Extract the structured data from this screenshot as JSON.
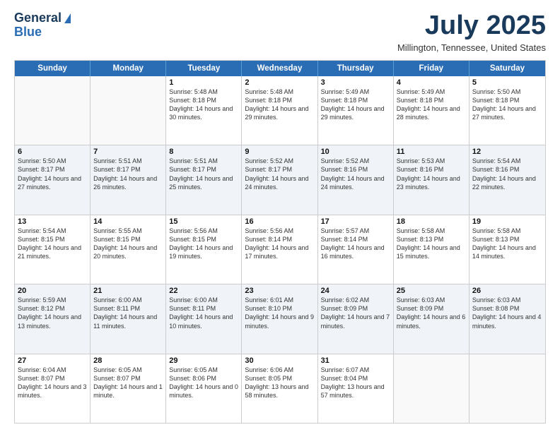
{
  "logo": {
    "line1": "General",
    "line2": "Blue"
  },
  "title": {
    "month_year": "July 2025",
    "location": "Millington, Tennessee, United States"
  },
  "weekdays": [
    "Sunday",
    "Monday",
    "Tuesday",
    "Wednesday",
    "Thursday",
    "Friday",
    "Saturday"
  ],
  "weeks": [
    [
      {
        "day": "",
        "sunrise": "",
        "sunset": "",
        "daylight": "",
        "empty": true
      },
      {
        "day": "",
        "sunrise": "",
        "sunset": "",
        "daylight": "",
        "empty": true
      },
      {
        "day": "1",
        "sunrise": "Sunrise: 5:48 AM",
        "sunset": "Sunset: 8:18 PM",
        "daylight": "Daylight: 14 hours and 30 minutes."
      },
      {
        "day": "2",
        "sunrise": "Sunrise: 5:48 AM",
        "sunset": "Sunset: 8:18 PM",
        "daylight": "Daylight: 14 hours and 29 minutes."
      },
      {
        "day": "3",
        "sunrise": "Sunrise: 5:49 AM",
        "sunset": "Sunset: 8:18 PM",
        "daylight": "Daylight: 14 hours and 29 minutes."
      },
      {
        "day": "4",
        "sunrise": "Sunrise: 5:49 AM",
        "sunset": "Sunset: 8:18 PM",
        "daylight": "Daylight: 14 hours and 28 minutes."
      },
      {
        "day": "5",
        "sunrise": "Sunrise: 5:50 AM",
        "sunset": "Sunset: 8:18 PM",
        "daylight": "Daylight: 14 hours and 27 minutes."
      }
    ],
    [
      {
        "day": "6",
        "sunrise": "Sunrise: 5:50 AM",
        "sunset": "Sunset: 8:17 PM",
        "daylight": "Daylight: 14 hours and 27 minutes."
      },
      {
        "day": "7",
        "sunrise": "Sunrise: 5:51 AM",
        "sunset": "Sunset: 8:17 PM",
        "daylight": "Daylight: 14 hours and 26 minutes."
      },
      {
        "day": "8",
        "sunrise": "Sunrise: 5:51 AM",
        "sunset": "Sunset: 8:17 PM",
        "daylight": "Daylight: 14 hours and 25 minutes."
      },
      {
        "day": "9",
        "sunrise": "Sunrise: 5:52 AM",
        "sunset": "Sunset: 8:17 PM",
        "daylight": "Daylight: 14 hours and 24 minutes."
      },
      {
        "day": "10",
        "sunrise": "Sunrise: 5:52 AM",
        "sunset": "Sunset: 8:16 PM",
        "daylight": "Daylight: 14 hours and 24 minutes."
      },
      {
        "day": "11",
        "sunrise": "Sunrise: 5:53 AM",
        "sunset": "Sunset: 8:16 PM",
        "daylight": "Daylight: 14 hours and 23 minutes."
      },
      {
        "day": "12",
        "sunrise": "Sunrise: 5:54 AM",
        "sunset": "Sunset: 8:16 PM",
        "daylight": "Daylight: 14 hours and 22 minutes."
      }
    ],
    [
      {
        "day": "13",
        "sunrise": "Sunrise: 5:54 AM",
        "sunset": "Sunset: 8:15 PM",
        "daylight": "Daylight: 14 hours and 21 minutes."
      },
      {
        "day": "14",
        "sunrise": "Sunrise: 5:55 AM",
        "sunset": "Sunset: 8:15 PM",
        "daylight": "Daylight: 14 hours and 20 minutes."
      },
      {
        "day": "15",
        "sunrise": "Sunrise: 5:56 AM",
        "sunset": "Sunset: 8:15 PM",
        "daylight": "Daylight: 14 hours and 19 minutes."
      },
      {
        "day": "16",
        "sunrise": "Sunrise: 5:56 AM",
        "sunset": "Sunset: 8:14 PM",
        "daylight": "Daylight: 14 hours and 17 minutes."
      },
      {
        "day": "17",
        "sunrise": "Sunrise: 5:57 AM",
        "sunset": "Sunset: 8:14 PM",
        "daylight": "Daylight: 14 hours and 16 minutes."
      },
      {
        "day": "18",
        "sunrise": "Sunrise: 5:58 AM",
        "sunset": "Sunset: 8:13 PM",
        "daylight": "Daylight: 14 hours and 15 minutes."
      },
      {
        "day": "19",
        "sunrise": "Sunrise: 5:58 AM",
        "sunset": "Sunset: 8:13 PM",
        "daylight": "Daylight: 14 hours and 14 minutes."
      }
    ],
    [
      {
        "day": "20",
        "sunrise": "Sunrise: 5:59 AM",
        "sunset": "Sunset: 8:12 PM",
        "daylight": "Daylight: 14 hours and 13 minutes."
      },
      {
        "day": "21",
        "sunrise": "Sunrise: 6:00 AM",
        "sunset": "Sunset: 8:11 PM",
        "daylight": "Daylight: 14 hours and 11 minutes."
      },
      {
        "day": "22",
        "sunrise": "Sunrise: 6:00 AM",
        "sunset": "Sunset: 8:11 PM",
        "daylight": "Daylight: 14 hours and 10 minutes."
      },
      {
        "day": "23",
        "sunrise": "Sunrise: 6:01 AM",
        "sunset": "Sunset: 8:10 PM",
        "daylight": "Daylight: 14 hours and 9 minutes."
      },
      {
        "day": "24",
        "sunrise": "Sunrise: 6:02 AM",
        "sunset": "Sunset: 8:09 PM",
        "daylight": "Daylight: 14 hours and 7 minutes."
      },
      {
        "day": "25",
        "sunrise": "Sunrise: 6:03 AM",
        "sunset": "Sunset: 8:09 PM",
        "daylight": "Daylight: 14 hours and 6 minutes."
      },
      {
        "day": "26",
        "sunrise": "Sunrise: 6:03 AM",
        "sunset": "Sunset: 8:08 PM",
        "daylight": "Daylight: 14 hours and 4 minutes."
      }
    ],
    [
      {
        "day": "27",
        "sunrise": "Sunrise: 6:04 AM",
        "sunset": "Sunset: 8:07 PM",
        "daylight": "Daylight: 14 hours and 3 minutes."
      },
      {
        "day": "28",
        "sunrise": "Sunrise: 6:05 AM",
        "sunset": "Sunset: 8:07 PM",
        "daylight": "Daylight: 14 hours and 1 minute."
      },
      {
        "day": "29",
        "sunrise": "Sunrise: 6:05 AM",
        "sunset": "Sunset: 8:06 PM",
        "daylight": "Daylight: 14 hours and 0 minutes."
      },
      {
        "day": "30",
        "sunrise": "Sunrise: 6:06 AM",
        "sunset": "Sunset: 8:05 PM",
        "daylight": "Daylight: 13 hours and 58 minutes."
      },
      {
        "day": "31",
        "sunrise": "Sunrise: 6:07 AM",
        "sunset": "Sunset: 8:04 PM",
        "daylight": "Daylight: 13 hours and 57 minutes."
      },
      {
        "day": "",
        "sunrise": "",
        "sunset": "",
        "daylight": "",
        "empty": true
      },
      {
        "day": "",
        "sunrise": "",
        "sunset": "",
        "daylight": "",
        "empty": true
      }
    ]
  ]
}
